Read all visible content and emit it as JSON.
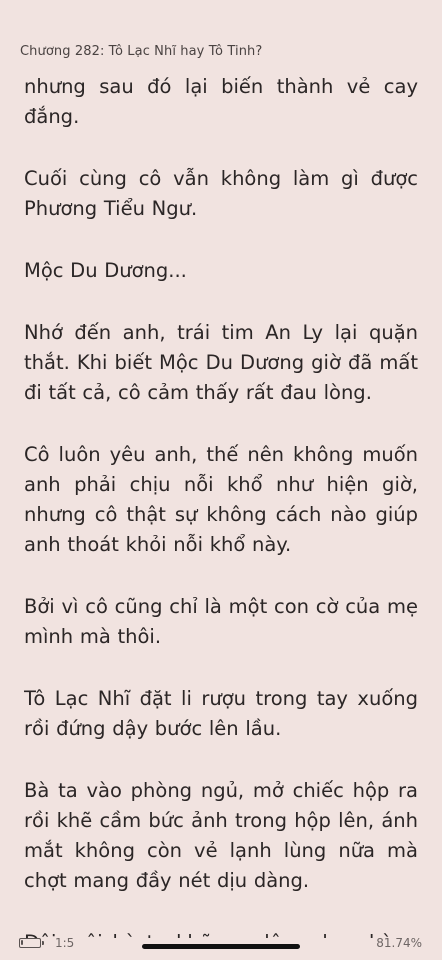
{
  "header": {
    "chapter_title": "Chương 282: Tô Lạc Nhĩ hay Tô Tinh?"
  },
  "reader": {
    "paragraphs": [
      "nhưng sau đó lại biến thành vẻ cay đắng.",
      "Cuối cùng cô vẫn không làm gì được Phương Tiểu Ngư.",
      "Mộc Du Dương...",
      "Nhớ đến anh, trái tim An Ly lại quặn thắt. Khi biết Mộc Du Dương giờ đã mất đi tất cả, cô cảm thấy rất đau lòng.",
      "Cô luôn yêu anh, thế nên không muốn anh phải chịu nỗi khổ như hiện giờ, nhưng cô thật sự không cách nào giúp anh thoát khỏi nỗi khổ này.",
      "Bởi vì cô cũng chỉ là một con cờ của mẹ mình mà thôi.",
      "Tô Lạc Nhĩ đặt li rượu trong tay xuống rồi đứng dậy bước lên lầu.",
      "Bà ta vào phòng ngủ, mở chiếc hộp ra rồi khẽ cầm bức ảnh trong hộp lên, ánh mắt không còn vẻ lạnh lùng nữa mà chợt mang đầy nét dịu dàng.",
      "Đôi môi bà ta khẽ run lên, nhẹ nhàng nói"
    ]
  },
  "status_bar": {
    "battery_icon": "battery-low-icon",
    "page": "1:5",
    "progress": "81.74%"
  },
  "colors": {
    "background": "#f1e3e0",
    "text": "#2b2626",
    "home_indicator": "#111111"
  }
}
